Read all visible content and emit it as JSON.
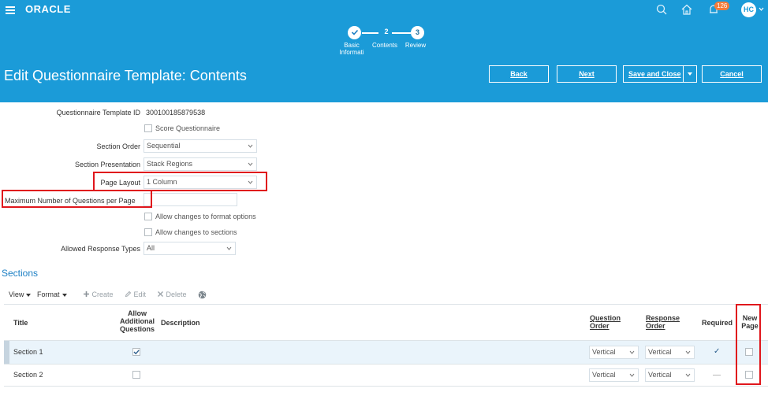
{
  "topbar": {
    "brand": "ORACLE",
    "notification_count": "126",
    "user_initials": "HC"
  },
  "train": {
    "steps": [
      {
        "number": "",
        "label": "Basic Informati",
        "state": "done"
      },
      {
        "number": "2",
        "label": "Contents",
        "state": "current"
      },
      {
        "number": "3",
        "label": "Review",
        "state": "future"
      }
    ]
  },
  "header": {
    "title": "Edit Questionnaire Template: Contents",
    "buttons": {
      "back": "Back",
      "next": "Next",
      "save_close": "Save and Close",
      "cancel": "Cancel"
    }
  },
  "form": {
    "template_id_label": "Questionnaire Template ID",
    "template_id_value": "300100185879538",
    "score_label": "Score Questionnaire",
    "section_order_label": "Section Order",
    "section_order_value": "Sequential",
    "section_presentation_label": "Section Presentation",
    "section_presentation_value": "Stack Regions",
    "page_layout_label": "Page Layout",
    "page_layout_value": "1 Column",
    "max_questions_label": "Maximum Number of Questions per Page",
    "max_questions_value": "",
    "allow_format_label": "Allow changes to format options",
    "allow_sections_label": "Allow changes to sections",
    "allowed_response_label": "Allowed Response Types",
    "allowed_response_value": "All"
  },
  "sections": {
    "title": "Sections",
    "toolbar": {
      "view": "View",
      "format": "Format",
      "create": "Create",
      "edit": "Edit",
      "delete": "Delete"
    },
    "columns": {
      "title": "Title",
      "allow_additional": "Allow Additional Questions",
      "description": "Description",
      "question_order": "Question Order",
      "response_order": "Response Order",
      "required": "Required",
      "new_page": "New Page"
    },
    "rows": [
      {
        "title": "Section 1",
        "allow_additional": true,
        "description": "",
        "question_order": "Vertical",
        "response_order": "Vertical",
        "required": "✓",
        "new_page": false
      },
      {
        "title": "Section 2",
        "allow_additional": false,
        "description": "",
        "question_order": "Vertical",
        "response_order": "Vertical",
        "required": "—",
        "new_page": false
      }
    ]
  },
  "colors": {
    "header_blue": "#1b9bd8",
    "highlight_red": "#e0161c",
    "section_title_blue": "#1b7fc4",
    "selected_row": "#eaf4fb"
  }
}
